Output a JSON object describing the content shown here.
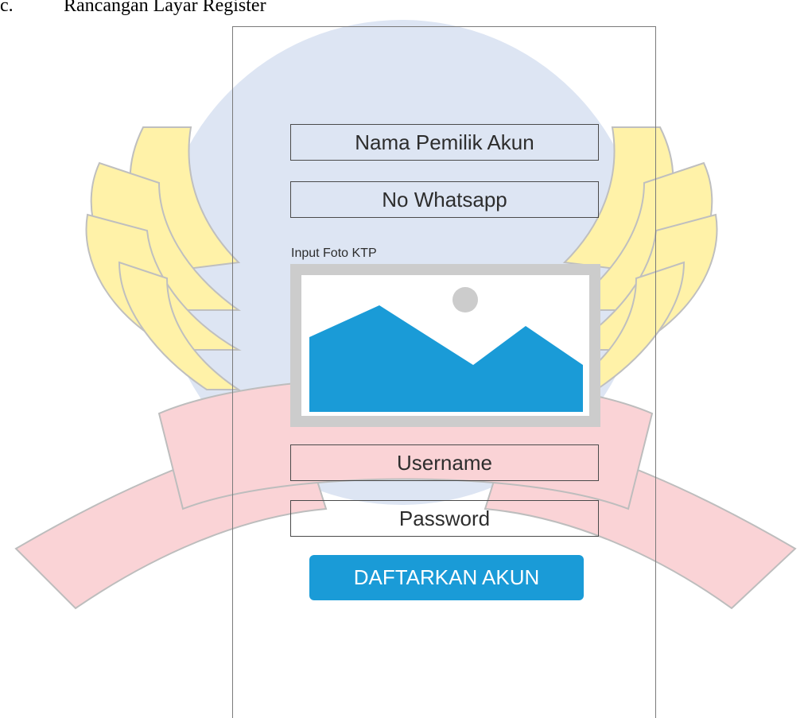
{
  "caption": {
    "number": "c.",
    "title": "Rancangan Layar Register"
  },
  "form": {
    "name_field": "Nama Pemilik Akun",
    "whatsapp_field": "No Whatsapp",
    "ktp_label": "Input Foto KTP",
    "username_field": "Username",
    "password_field": "Password",
    "submit_button": "DAFTARKAN AKUN"
  },
  "colors": {
    "accent": "#1a9bd7",
    "image_frame": "#cccccc",
    "watermark_yellow": "#fff2a8",
    "watermark_blue": "#dde5f3",
    "watermark_pink": "#fad3d6"
  },
  "icons": {
    "ktp_placeholder": "image-placeholder-icon",
    "background": "campus-logo-watermark"
  }
}
